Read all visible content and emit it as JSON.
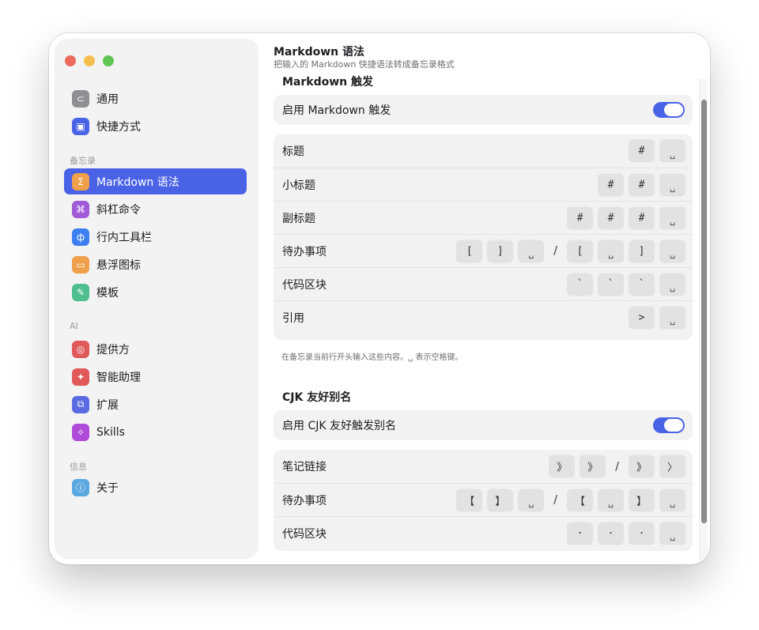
{
  "sidebar": {
    "groups": {
      "memo": "备忘录",
      "ai": "AI",
      "info": "信息"
    },
    "items": [
      {
        "label": "通用",
        "icon": "toggle-icon",
        "color": "#8e8e93"
      },
      {
        "label": "快捷方式",
        "icon": "shortcut-icon",
        "color": "#4a63e6"
      },
      {
        "label": "Markdown 语法",
        "icon": "sigma-icon",
        "color": "#f0a04b"
      },
      {
        "label": "斜杠命令",
        "icon": "command-icon",
        "color": "#a05ad8"
      },
      {
        "label": "行内工具栏",
        "icon": "toolbar-icon",
        "color": "#3d7ff0"
      },
      {
        "label": "悬浮图标",
        "icon": "float-icon",
        "color": "#f0a04b"
      },
      {
        "label": "模板",
        "icon": "template-icon",
        "color": "#4fbf8f"
      },
      {
        "label": "提供方",
        "icon": "provider-icon",
        "color": "#e05a5a"
      },
      {
        "label": "智能助理",
        "icon": "assistant-icon",
        "color": "#e05a5a"
      },
      {
        "label": "扩展",
        "icon": "extension-icon",
        "color": "#5a6ae0"
      },
      {
        "label": "Skills",
        "icon": "skills-icon",
        "color": "#b04ad8"
      },
      {
        "label": "关于",
        "icon": "info-icon",
        "color": "#5aa8e0"
      }
    ]
  },
  "header": {
    "title": "Markdown 语法",
    "subtitle": "把输入的 Markdown 快捷语法转成备忘录格式"
  },
  "markdown": {
    "section_title": "Markdown 触发",
    "enable_label": "启用 Markdown 触发",
    "enabled": true,
    "rows": [
      {
        "label": "标题",
        "keys": [
          "#",
          "␣"
        ]
      },
      {
        "label": "小标题",
        "keys": [
          "#",
          "#",
          "␣"
        ]
      },
      {
        "label": "副标题",
        "keys": [
          "#",
          "#",
          "#",
          "␣"
        ]
      },
      {
        "label": "待办事项",
        "keys": [
          "[",
          "]",
          "␣",
          "/",
          "[",
          "␣",
          "]",
          "␣"
        ]
      },
      {
        "label": "代码区块",
        "keys": [
          "`",
          "`",
          "`",
          "␣"
        ]
      },
      {
        "label": "引用",
        "keys": [
          ">",
          "␣"
        ]
      }
    ],
    "hint": "在备忘录当前行开头输入这些内容。␣ 表示空格键。"
  },
  "cjk": {
    "section_title": "CJK 友好别名",
    "enable_label": "启用 CJK 友好触发别名",
    "enabled": true,
    "rows": [
      {
        "label": "笔记链接",
        "keys": [
          "》",
          "》",
          "/",
          "》",
          "〉"
        ]
      },
      {
        "label": "待办事项",
        "keys": [
          "【",
          "】",
          "␣",
          "/",
          "【",
          "␣",
          "】",
          "␣"
        ]
      },
      {
        "label": "代码区块",
        "keys": [
          "·",
          "·",
          "·",
          "␣"
        ]
      }
    ]
  },
  "colors": {
    "accent": "#4a63e6"
  }
}
